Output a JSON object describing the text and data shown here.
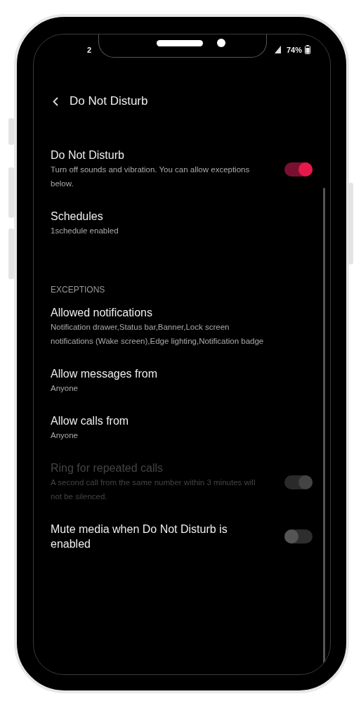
{
  "status_bar": {
    "time": "2",
    "battery": "74%"
  },
  "header": {
    "title": "Do Not Disturb"
  },
  "sections": [
    {
      "items": [
        {
          "kind": "toggle",
          "title": "Do Not Disturb",
          "subtitle": "Turn off sounds and vibration. You can allow exceptions below.",
          "on": true,
          "disabled": false
        },
        {
          "kind": "link",
          "title": "Schedules",
          "subtitle": "1schedule enabled",
          "disabled": false
        }
      ]
    },
    {
      "header": "EXCEPTIONS",
      "items": [
        {
          "kind": "link",
          "title": "Allowed notifications",
          "subtitle": "Notification drawer,Status bar,Banner,Lock screen notifications (Wake screen),Edge lighting,Notification badge",
          "disabled": false
        },
        {
          "kind": "link",
          "title": "Allow messages from",
          "subtitle": "Anyone",
          "disabled": false
        },
        {
          "kind": "link",
          "title": "Allow calls from",
          "subtitle": "Anyone",
          "disabled": false
        },
        {
          "kind": "toggle",
          "title": "Ring for repeated calls",
          "subtitle": "A second call from the same number within 3 minutes will not be silenced.",
          "on": true,
          "disabled": true
        },
        {
          "kind": "toggle",
          "title": "Mute media when Do Not Disturb is enabled",
          "on": false,
          "disabled": false
        }
      ]
    }
  ]
}
